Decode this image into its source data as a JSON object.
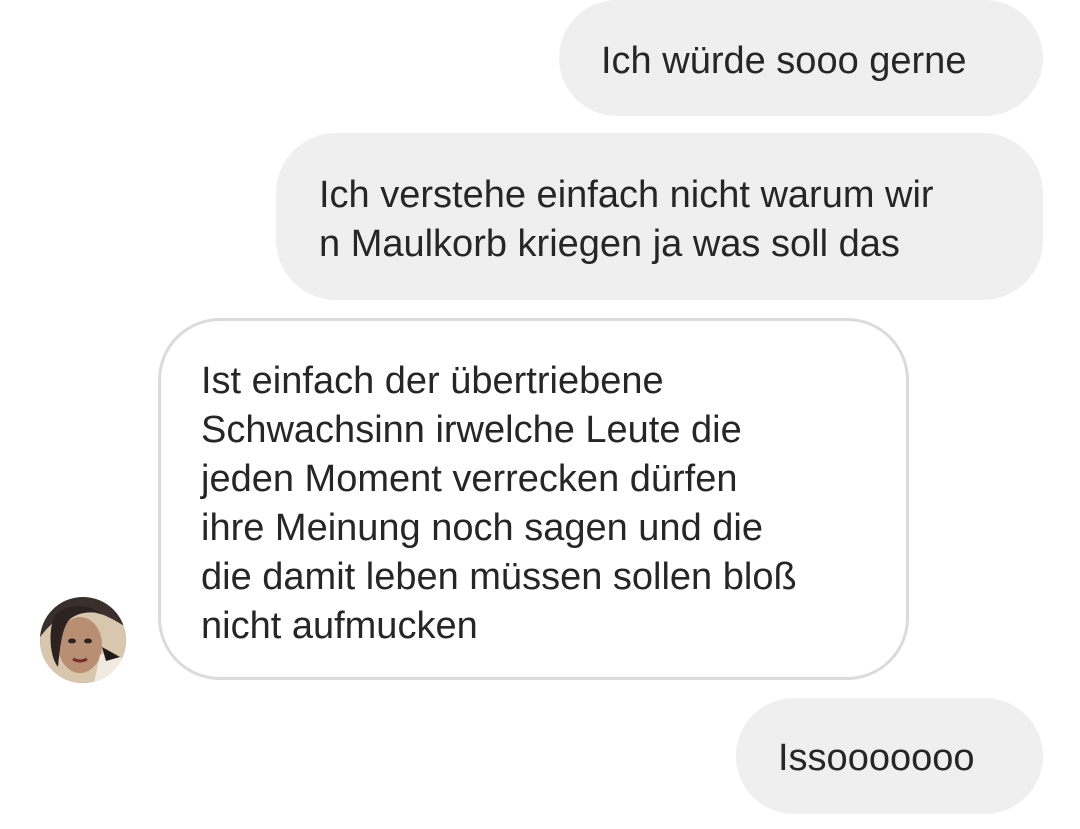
{
  "conversation": {
    "messages": [
      {
        "direction": "outgoing",
        "text": "Ich würde sooo gerne"
      },
      {
        "direction": "outgoing",
        "text": "Ich verstehe einfach nicht warum wir\nn Maulkorb kriegen ja was soll das"
      },
      {
        "direction": "incoming",
        "text": "Ist einfach der übertriebene\nSchwachsinn irwelche Leute die\njeden Moment verrecken dürfen\nihre Meinung noch sagen und die\ndie damit leben müssen sollen bloß\nnicht aufmucken"
      },
      {
        "direction": "outgoing",
        "text": "Issooooooo"
      }
    ],
    "avatar": {
      "icon": "profile-photo"
    }
  },
  "colors": {
    "sent_bubble": "#efefef",
    "received_border": "#dbdbdb",
    "text": "#262626",
    "background": "#ffffff"
  }
}
